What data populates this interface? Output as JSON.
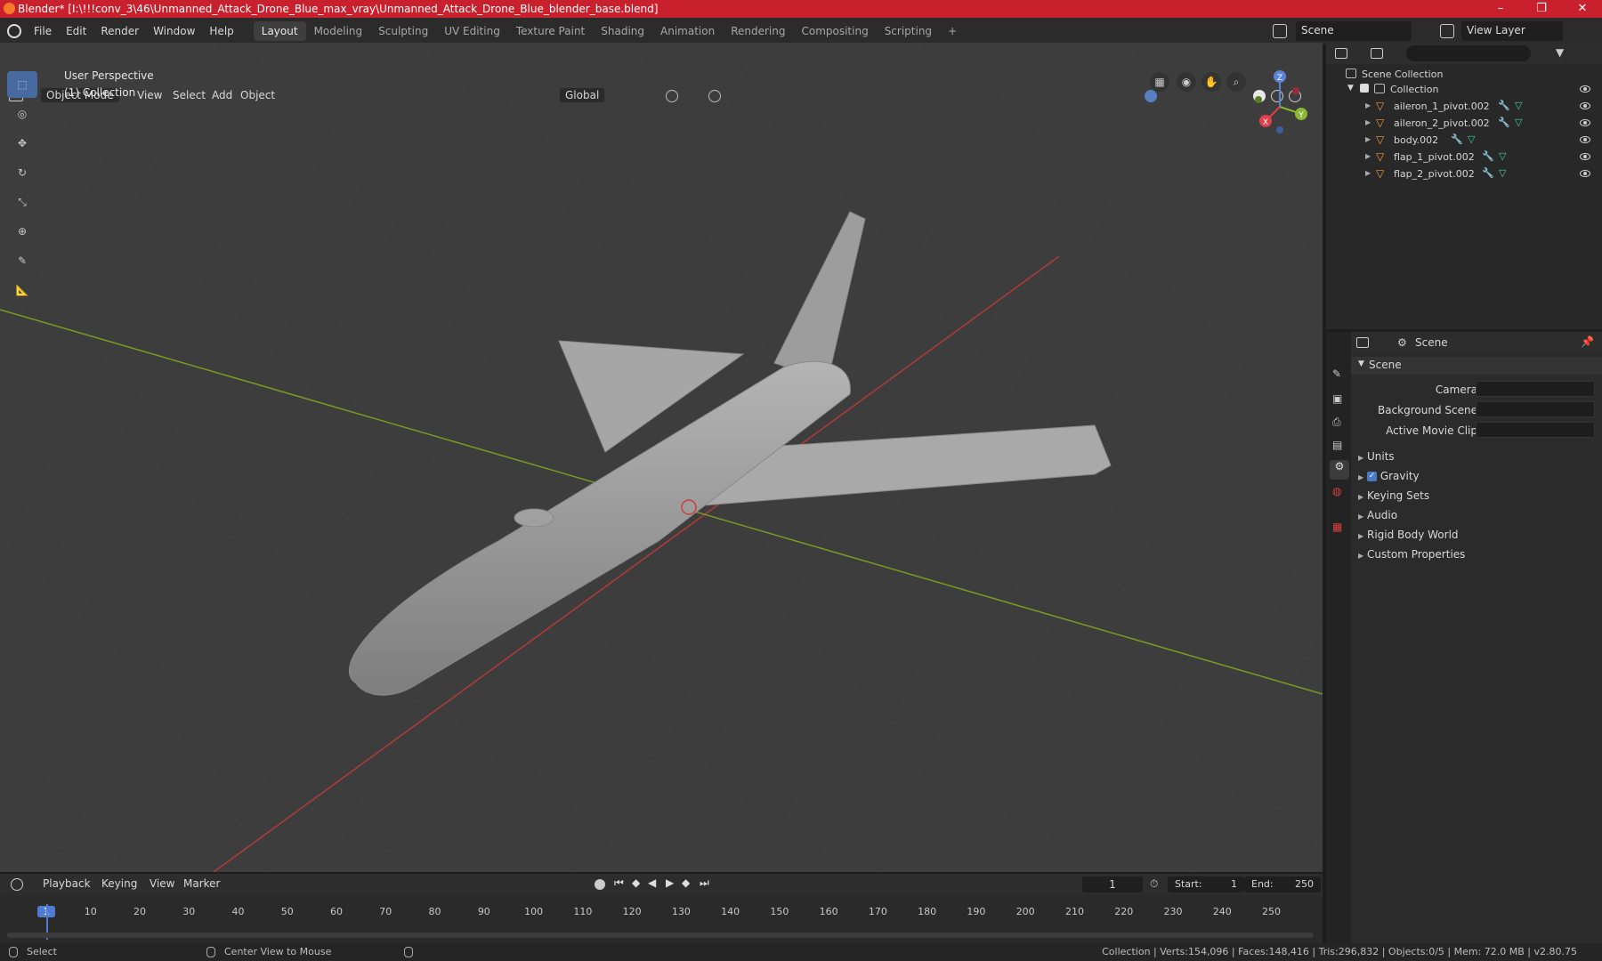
{
  "window": {
    "title": "Blender* [I:\\!!!conv_3\\46\\Unmanned_Attack_Drone_Blue_max_vray\\Unmanned_Attack_Drone_Blue_blender_base.blend]",
    "minimize": "–",
    "maximize": "❐",
    "close": "✕"
  },
  "menu": {
    "items": [
      "File",
      "Edit",
      "Render",
      "Window",
      "Help"
    ],
    "workspaces": [
      "Layout",
      "Modeling",
      "Sculpting",
      "UV Editing",
      "Texture Paint",
      "Shading",
      "Animation",
      "Rendering",
      "Compositing",
      "Scripting"
    ],
    "active_workspace": "Layout",
    "add_tab": "+",
    "scene_label": "Scene",
    "view_layer_label": "View Layer"
  },
  "viewport_header": {
    "mode": "Object Mode",
    "menus": [
      "View",
      "Select",
      "Add",
      "Object"
    ],
    "transform_orientation": "Global"
  },
  "viewport": {
    "overlay_line1": "User Perspective",
    "overlay_line2": "(1) Collection",
    "gizmo": {
      "x": "X",
      "y": "Y",
      "z": "Z"
    },
    "colors": {
      "background": "#3d3d3d",
      "x_axis": "#b33a3a",
      "y_axis": "#7a9b1f",
      "model": "#9a9a9a"
    }
  },
  "outliner": {
    "root": "Scene Collection",
    "collection": "Collection",
    "items": [
      "aileron_1_pivot.002",
      "aileron_2_pivot.002",
      "body.002",
      "flap_1_pivot.002",
      "flap_2_pivot.002"
    ]
  },
  "properties": {
    "header": "Scene",
    "panel_title": "Scene",
    "camera_label": "Camera",
    "background_scene_label": "Background Scene",
    "active_movie_clip_label": "Active Movie Clip",
    "sections": [
      "Units",
      "Gravity",
      "Keying Sets",
      "Audio",
      "Rigid Body World",
      "Custom Properties"
    ],
    "gravity_checked": true
  },
  "timeline": {
    "menus": [
      "Playback",
      "Keying",
      "View",
      "Marker"
    ],
    "current_frame": "1",
    "start_label": "Start:",
    "start_value": "1",
    "end_label": "End:",
    "end_value": "250",
    "ticks": [
      "1",
      "10",
      "20",
      "30",
      "40",
      "50",
      "60",
      "70",
      "80",
      "90",
      "100",
      "110",
      "120",
      "130",
      "140",
      "150",
      "160",
      "170",
      "180",
      "190",
      "200",
      "210",
      "220",
      "230",
      "240",
      "250"
    ]
  },
  "statusbar": {
    "select": "Select",
    "center_view": "Center View to Mouse",
    "stats": "Collection | Verts:154,096 | Faces:148,416 | Tris:296,832 | Objects:0/5 | Mem: 72.0 MB | v2.80.75"
  }
}
